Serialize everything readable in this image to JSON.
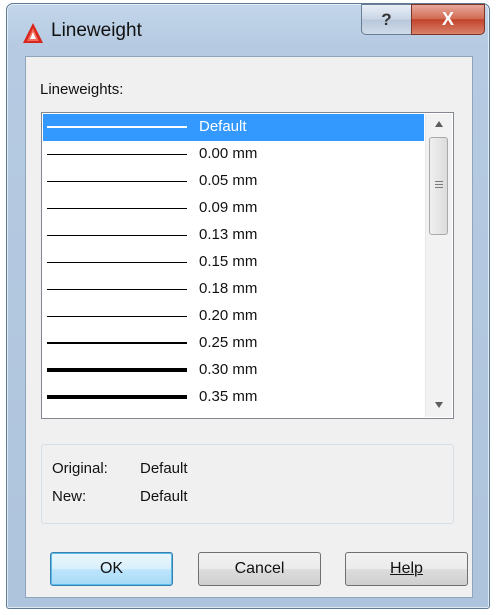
{
  "window": {
    "title": "Lineweight",
    "help_glyph": "?",
    "close_glyph": "X"
  },
  "list": {
    "label": "Lineweights:",
    "items": [
      {
        "label": "Default",
        "selected": true
      },
      {
        "label": "0.00 mm"
      },
      {
        "label": "0.05 mm"
      },
      {
        "label": "0.09 mm"
      },
      {
        "label": "0.13 mm"
      },
      {
        "label": "0.15 mm"
      },
      {
        "label": "0.18 mm"
      },
      {
        "label": "0.20 mm"
      },
      {
        "label": "0.25 mm"
      },
      {
        "label": "0.30 mm"
      },
      {
        "label": "0.35 mm"
      }
    ]
  },
  "info": {
    "original_label": "Original:",
    "original_value": "Default",
    "new_label": "New:",
    "new_value": "Default"
  },
  "buttons": {
    "ok": "OK",
    "cancel": "Cancel",
    "help": "Help"
  },
  "colors": {
    "selection": "#3399ff",
    "close_button": "#c2432b",
    "frame": "#b6cbe2"
  },
  "icons": {
    "app": "autocad-logo-icon"
  }
}
